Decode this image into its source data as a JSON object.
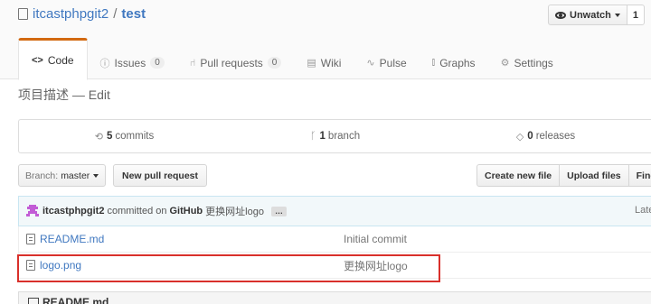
{
  "repo": {
    "owner": "itcastphpgit2",
    "separator": "/",
    "name": "test"
  },
  "watch": {
    "label": "Unwatch",
    "count": "1"
  },
  "tabs": [
    {
      "icon": "<>",
      "label": "Code",
      "count": null
    },
    {
      "icon": "ⓘ",
      "label": "Issues",
      "count": "0"
    },
    {
      "icon": "⑁",
      "label": "Pull requests",
      "count": "0"
    },
    {
      "icon": "▤",
      "label": "Wiki",
      "count": null
    },
    {
      "icon": "∿",
      "label": "Pulse",
      "count": null
    },
    {
      "icon": "⫾",
      "label": "Graphs",
      "count": null
    },
    {
      "icon": "⚙",
      "label": "Settings",
      "count": null
    }
  ],
  "description": "项目描述 — Edit",
  "summary": {
    "commits_count": "5",
    "commits_label": "commits",
    "branch_count": "1",
    "branch_label": "branch",
    "releases_count": "0",
    "releases_label": "releases"
  },
  "toolbar": {
    "branch_prefix": "Branch:",
    "branch_name": "master",
    "new_pr": "New pull request",
    "create_file": "Create new file",
    "upload_files": "Upload files",
    "find_file": "Find"
  },
  "commit": {
    "author": "itcastphpgit2",
    "committed_on": "committed on",
    "platform": "GitHub",
    "message": "更换网址logo",
    "ellipsis": "…",
    "latest": "Late"
  },
  "files": [
    {
      "name": "README.md",
      "message": "Initial commit"
    },
    {
      "name": "logo.png",
      "message": "更换网址logo"
    }
  ],
  "readme": {
    "title": "README.md"
  },
  "colors": {
    "accent": "#d26911",
    "link": "#4078c0",
    "highlight": "#d9302b"
  }
}
